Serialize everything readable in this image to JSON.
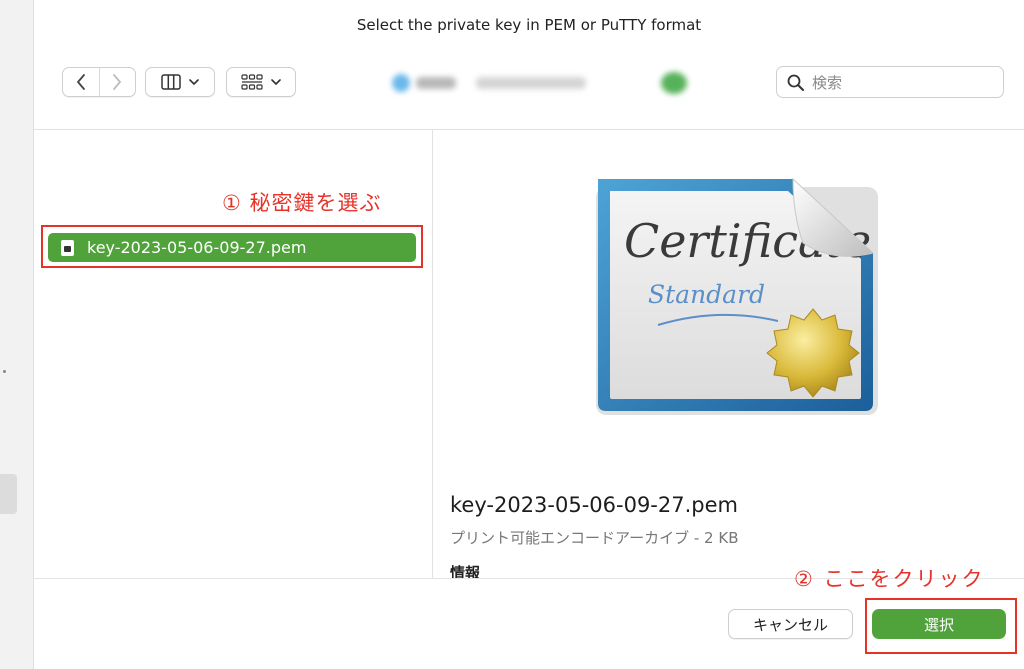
{
  "dialog": {
    "title": "Select the private key in PEM or PuTTY format"
  },
  "toolbar": {
    "back_icon": "chevron-left-icon",
    "forward_icon": "chevron-right-icon",
    "view_icon": "column-view-icon",
    "group_icon": "grid-view-icon"
  },
  "search": {
    "placeholder": "検索"
  },
  "files": [
    {
      "name": "key-2023-05-06-09-27.pem",
      "selected": true
    }
  ],
  "preview": {
    "name": "key-2023-05-06-09-27.pem",
    "kind": "プリント可能エンコードアーカイブ - 2 KB",
    "info_heading": "情報",
    "icon": "certificate-icon"
  },
  "annotations": {
    "step1": "① 秘密鍵を選ぶ",
    "step2": "② ここをクリック",
    "color": "#e6332a"
  },
  "footer": {
    "cancel_label": "キャンセル",
    "select_label": "選択"
  },
  "colors": {
    "accent": "#4fa33a"
  }
}
